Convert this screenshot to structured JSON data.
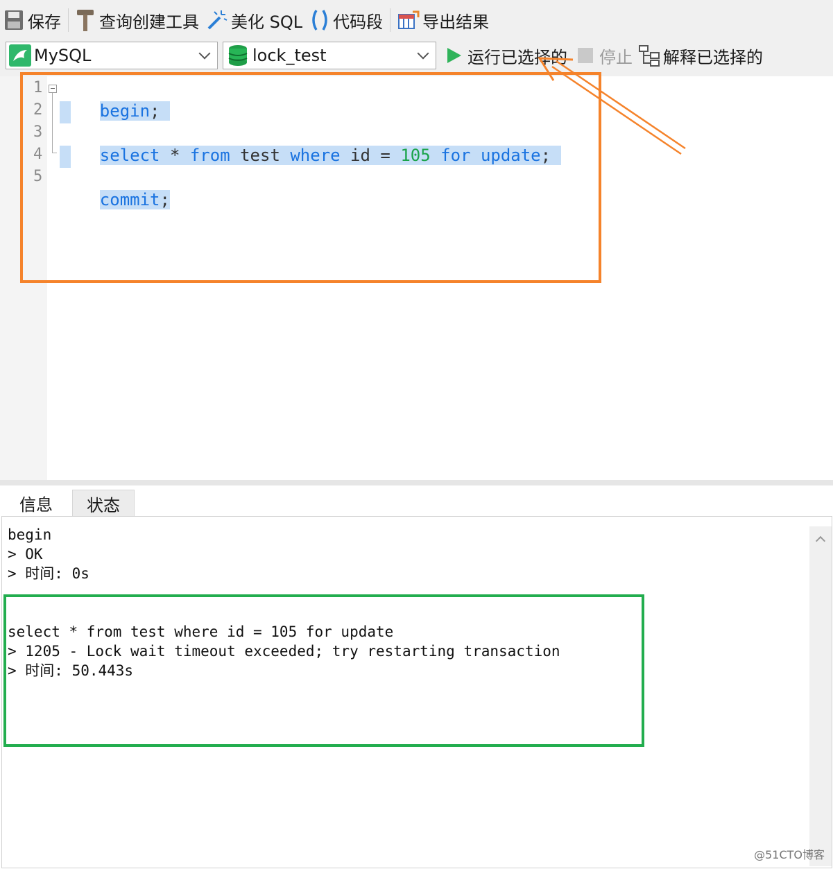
{
  "toolbar": {
    "save_label": "保存",
    "query_builder_label": "查询创建工具",
    "beautify_label": "美化 SQL",
    "snippet_label": "代码段",
    "export_label": "导出结果"
  },
  "controls": {
    "connection_type": "MySQL",
    "database": "lock_test",
    "run_selected_label": "运行已选择的",
    "stop_label": "停止",
    "explain_selected_label": "解释已选择的"
  },
  "editor": {
    "line_numbers": [
      "1",
      "2",
      "3",
      "4",
      "5"
    ],
    "line1": {
      "kw1": "begin",
      "semi": ";"
    },
    "line3": {
      "t1": "select",
      "t2": " * ",
      "t3": "from",
      "t4": " test ",
      "t5": "where",
      "t6": " id = ",
      "t7": "105",
      "t8": " ",
      "t9": "for",
      "t10": " ",
      "t11": "update",
      "t12": ";"
    },
    "line5": {
      "kw1": "commit",
      "semi": ";"
    }
  },
  "tabs": {
    "info": "信息",
    "status": "状态"
  },
  "output": {
    "lines": [
      "begin",
      "> OK",
      "> 时间: 0s",
      "",
      "",
      "select * from test where id = 105 for update",
      "> 1205 - Lock wait timeout exceeded; try restarting transaction",
      "> 时间: 50.443s"
    ]
  },
  "watermark": "@51CTO博客",
  "colors": {
    "annotation_orange": "#f5832b",
    "annotation_green": "#22ad4e",
    "keyword_blue": "#1a73e0",
    "number_green": "#1aa34a",
    "selection": "#c6def7"
  }
}
